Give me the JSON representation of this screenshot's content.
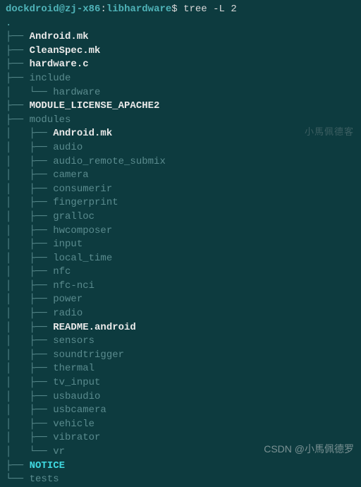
{
  "prompt": {
    "user": "dockdroid",
    "at": "@",
    "host": "zj-x86",
    "colon": ":",
    "path": "libhardware",
    "dollar": "$",
    "command": "tree",
    "option": "-L 2"
  },
  "root_dot": ".",
  "tree": {
    "lines": [
      {
        "branch": "├── ",
        "name": "Android.mk",
        "cls": "file-bold"
      },
      {
        "branch": "├── ",
        "name": "CleanSpec.mk",
        "cls": "file-bold"
      },
      {
        "branch": "├── ",
        "name": "hardware.c",
        "cls": "file-bold"
      },
      {
        "branch": "├── ",
        "name": "include",
        "cls": "dir"
      },
      {
        "branch": "│   └── ",
        "name": "hardware",
        "cls": "dir"
      },
      {
        "branch": "├── ",
        "name": "MODULE_LICENSE_APACHE2",
        "cls": "file-bold"
      },
      {
        "branch": "├── ",
        "name": "modules",
        "cls": "dir"
      },
      {
        "branch": "│   ├── ",
        "name": "Android.mk",
        "cls": "file-bold"
      },
      {
        "branch": "│   ├── ",
        "name": "audio",
        "cls": "dir"
      },
      {
        "branch": "│   ├── ",
        "name": "audio_remote_submix",
        "cls": "dir"
      },
      {
        "branch": "│   ├── ",
        "name": "camera",
        "cls": "dir"
      },
      {
        "branch": "│   ├── ",
        "name": "consumerir",
        "cls": "dir"
      },
      {
        "branch": "│   ├── ",
        "name": "fingerprint",
        "cls": "dir"
      },
      {
        "branch": "│   ├── ",
        "name": "gralloc",
        "cls": "dir"
      },
      {
        "branch": "│   ├── ",
        "name": "hwcomposer",
        "cls": "dir"
      },
      {
        "branch": "│   ├── ",
        "name": "input",
        "cls": "dir"
      },
      {
        "branch": "│   ├── ",
        "name": "local_time",
        "cls": "dir"
      },
      {
        "branch": "│   ├── ",
        "name": "nfc",
        "cls": "dir"
      },
      {
        "branch": "│   ├── ",
        "name": "nfc-nci",
        "cls": "dir"
      },
      {
        "branch": "│   ├── ",
        "name": "power",
        "cls": "dir"
      },
      {
        "branch": "│   ├── ",
        "name": "radio",
        "cls": "dir"
      },
      {
        "branch": "│   ├── ",
        "name": "README.android",
        "cls": "file-bold"
      },
      {
        "branch": "│   ├── ",
        "name": "sensors",
        "cls": "dir"
      },
      {
        "branch": "│   ├── ",
        "name": "soundtrigger",
        "cls": "dir"
      },
      {
        "branch": "│   ├── ",
        "name": "thermal",
        "cls": "dir"
      },
      {
        "branch": "│   ├── ",
        "name": "tv_input",
        "cls": "dir"
      },
      {
        "branch": "│   ├── ",
        "name": "usbaudio",
        "cls": "dir"
      },
      {
        "branch": "│   ├── ",
        "name": "usbcamera",
        "cls": "dir"
      },
      {
        "branch": "│   ├── ",
        "name": "vehicle",
        "cls": "dir"
      },
      {
        "branch": "│   ├── ",
        "name": "vibrator",
        "cls": "dir"
      },
      {
        "branch": "│   └── ",
        "name": "vr",
        "cls": "dir"
      },
      {
        "branch": "├── ",
        "name": "NOTICE",
        "cls": "notice"
      },
      {
        "branch": "└── ",
        "name": "tests",
        "cls": "dir"
      }
    ]
  },
  "watermarks": {
    "right": "小馬佩德客",
    "bottom": "CSDN @小馬佩德罗"
  }
}
